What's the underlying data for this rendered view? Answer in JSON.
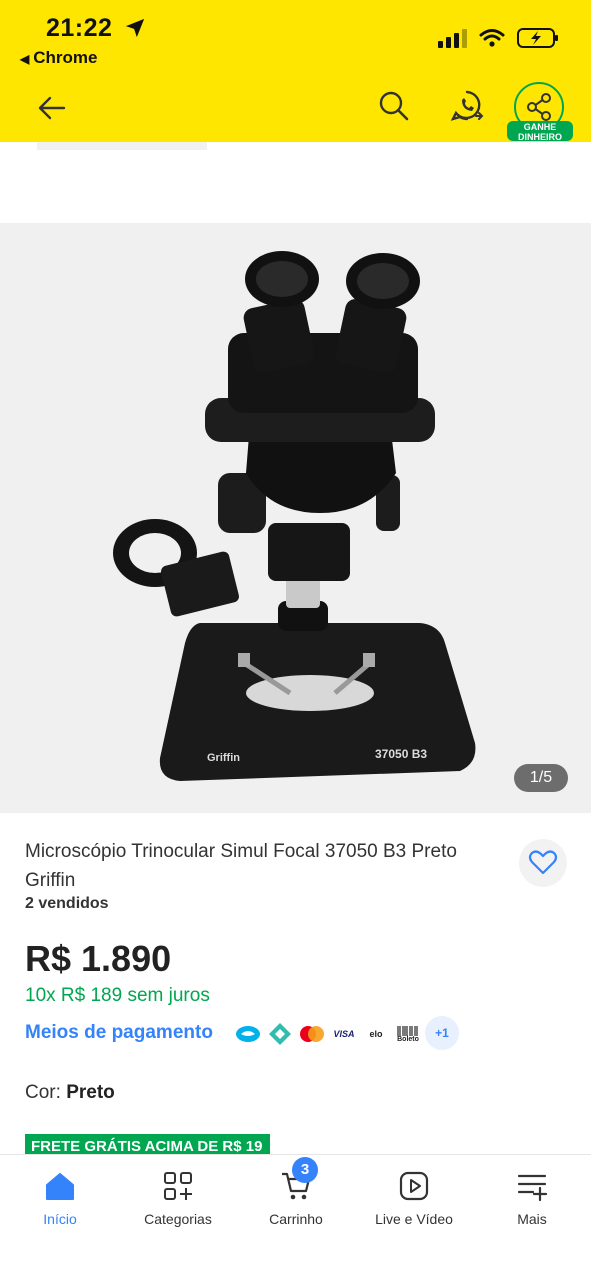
{
  "status_bar": {
    "time": "21:22",
    "back_app": "Chrome"
  },
  "header": {
    "share_badge": "GANHE DINHEIRO"
  },
  "product": {
    "image_counter": "1/5",
    "title": "Microscópio Trinocular Simul Focal 37050 B3 Preto Griffin",
    "sold": "2 vendidos",
    "price": "R$ 1.890",
    "installments": "10x R$ 189 sem juros",
    "payment_link": "Meios de pagamento",
    "payment_icons": [
      {
        "name": "mercado-pago-icon",
        "label": ""
      },
      {
        "name": "pix-icon",
        "label": ""
      },
      {
        "name": "mastercard-icon",
        "label": ""
      },
      {
        "name": "visa-icon",
        "label": "VISA"
      },
      {
        "name": "elo-icon",
        "label": "elo"
      },
      {
        "name": "boleto-icon",
        "label": "Boleto"
      },
      {
        "name": "more-payments-icon",
        "label": "+1"
      }
    ],
    "color_label": "Cor:",
    "color_value": "Preto",
    "shipping_badge": "FRETE GRÁTIS ACIMA DE R$ 19",
    "image_text_brand": "Griffin",
    "image_text_model": "37050 B3"
  },
  "bottom_nav": {
    "items": [
      {
        "label": "Início",
        "icon": "home-icon",
        "active": true
      },
      {
        "label": "Categorias",
        "icon": "categories-icon",
        "active": false
      },
      {
        "label": "Carrinho",
        "icon": "cart-icon",
        "active": false
      },
      {
        "label": "Live e Vídeo",
        "icon": "play-video-icon",
        "active": false
      },
      {
        "label": "Mais",
        "icon": "menu-plus-icon",
        "active": false
      }
    ],
    "cart_count": "3"
  },
  "colors": {
    "brand_yellow": "#ffe600",
    "link_blue": "#3483fa",
    "green": "#00a650"
  }
}
